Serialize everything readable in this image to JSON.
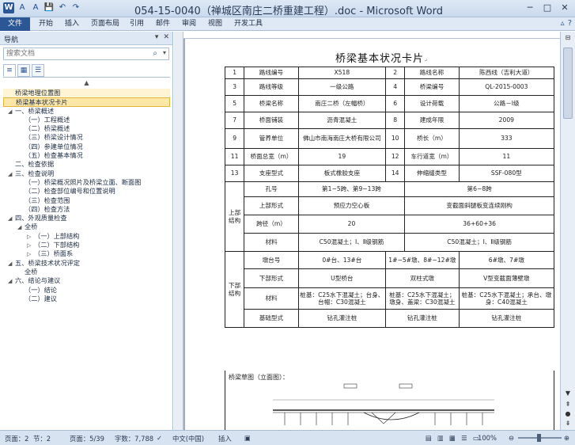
{
  "window": {
    "title": "054-15-0040（禅城区南庄二桥重建工程）.doc - Microsoft Word"
  },
  "qat": {
    "save": "💾",
    "undo": "↶",
    "redo": "↷"
  },
  "ribbon": {
    "file": "文件",
    "tabs": [
      "开始",
      "插入",
      "页面布局",
      "引用",
      "邮件",
      "审阅",
      "视图",
      "开发工具"
    ]
  },
  "nav": {
    "title": "导航",
    "search_placeholder": "搜索文档",
    "items": [
      {
        "label": "桥梁地理位置图",
        "level": 0,
        "tog": ""
      },
      {
        "label": "桥梁基本状况卡片",
        "level": 0,
        "tog": "",
        "selected": true
      },
      {
        "label": "一、桥梁概述",
        "level": 0,
        "tog": "◢"
      },
      {
        "label": "（一）工程概述",
        "level": 1,
        "tog": ""
      },
      {
        "label": "（二）桥梁概述",
        "level": 1,
        "tog": ""
      },
      {
        "label": "（三）桥梁设计情况",
        "level": 1,
        "tog": ""
      },
      {
        "label": "（四）参建单位情况",
        "level": 1,
        "tog": ""
      },
      {
        "label": "（五）检查基本情况",
        "level": 1,
        "tog": ""
      },
      {
        "label": "二、检查依据",
        "level": 0,
        "tog": ""
      },
      {
        "label": "三、检查说明",
        "level": 0,
        "tog": "◢"
      },
      {
        "label": "（一）桥梁概况照片及桥梁立面、断面图",
        "level": 1,
        "tog": ""
      },
      {
        "label": "（二）检查部位编号和位置说明",
        "level": 1,
        "tog": ""
      },
      {
        "label": "（三）检查范围",
        "level": 1,
        "tog": ""
      },
      {
        "label": "（四）检查方法",
        "level": 1,
        "tog": ""
      },
      {
        "label": "四、外观质量检查",
        "level": 0,
        "tog": "◢"
      },
      {
        "label": "全桥",
        "level": 1,
        "tog": "◢"
      },
      {
        "label": "（一）上部结构",
        "level": 2,
        "tog": "▷"
      },
      {
        "label": "（二）下部结构",
        "level": 2,
        "tog": "▷"
      },
      {
        "label": "（三）桥面系",
        "level": 2,
        "tog": "▷"
      },
      {
        "label": "五、桥梁技术状况评定",
        "level": 0,
        "tog": "◢"
      },
      {
        "label": "全桥",
        "level": 1,
        "tog": ""
      },
      {
        "label": "六、结论与建议",
        "level": 0,
        "tog": "◢"
      },
      {
        "label": "（一）结论",
        "level": 1,
        "tog": ""
      },
      {
        "label": "（二）建议",
        "level": 1,
        "tog": ""
      }
    ]
  },
  "doc": {
    "title": "桥梁基本状况卡片",
    "rows": [
      [
        "1",
        "路线编号",
        "X518",
        "2",
        "路线名称",
        "陈西线（吉利大道）"
      ],
      [
        "3",
        "路线等级",
        "一级公路",
        "4",
        "桥梁编号",
        "QL-2015-0003"
      ],
      [
        "5",
        "桥梁名称",
        "南庄二桥（左幅桥）",
        "6",
        "设计荷载",
        "公路－I级"
      ],
      [
        "7",
        "桥面铺装",
        "沥青混凝土",
        "8",
        "建成年限",
        "2009"
      ],
      [
        "9",
        "管养单位",
        "佛山市南海南庄大桥有限公司",
        "10",
        "桥长（m）",
        "333"
      ],
      [
        "11",
        "桥面总宽（m）",
        "19",
        "12",
        "车行道宽（m）",
        "11"
      ],
      [
        "13",
        "支座型式",
        "板式橡胶支座",
        "14",
        "伸缩缝类型",
        "SSF-080型"
      ]
    ],
    "upper": {
      "side": "上部结构",
      "span_label": "孔号",
      "span_a": "第1~5跨、第9~13跨",
      "span_b": "第6~8跨",
      "form_label": "上部形式",
      "form_a": "预应力空心板",
      "form_b": "变截面斜腿板变连续刚构",
      "length_label": "跨径（m）",
      "length_a": "20",
      "length_b": "36+60+36",
      "mat_label": "材料",
      "mat_a": "C50混凝土；Ⅰ、Ⅱ级钢筋",
      "mat_b": "C50混凝土；Ⅰ、Ⅱ级钢筋"
    },
    "lower": {
      "side": "下部结构",
      "pier_label": "墩台号",
      "pier_a": "0#台、13#台",
      "pier_b": "1#~5#墩、8#~12#墩",
      "pier_c": "6#墩、7#墩",
      "form_label": "下部形式",
      "form_a": "U型桥台",
      "form_b": "双柱式墩",
      "form_c": "V型变截面薄壁墩",
      "mat_label": "材料",
      "mat_a": "桩基：C25水下混凝土；台身、台帽：C30混凝土",
      "mat_b": "桩基：C25水下混凝土；墩身、盖梁：C30混凝土",
      "mat_c": "桩基：C25水下混凝土；承台、墩身：C40混凝土",
      "found_label": "基础型式",
      "found_a": "钻孔灌注桩",
      "found_b": "钻孔灌注桩",
      "found_c": "钻孔灌注桩"
    },
    "sketch_label": "桥梁草图（立面图）："
  },
  "status": {
    "page": "页面：2",
    "section": "节：2",
    "pages": "页面：5/39",
    "words": "字数：7,788",
    "lang": "中文(中国)",
    "mode": "插入",
    "zoom": "100%"
  }
}
